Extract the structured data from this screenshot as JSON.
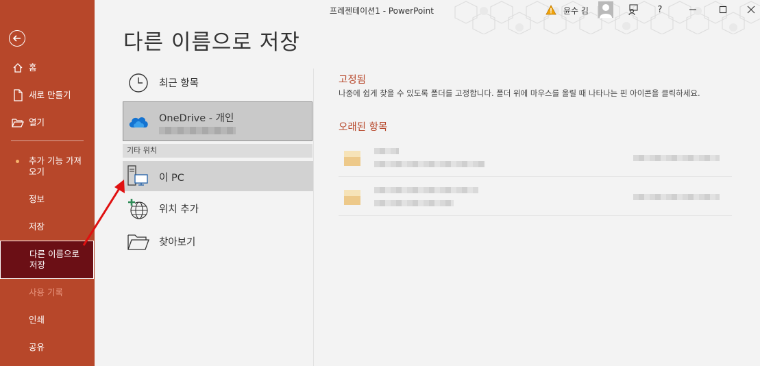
{
  "titlebar": {
    "doc_title": "프레젠테이션1  -  PowerPoint",
    "user_name": "윤수 김",
    "help": "?",
    "icons": [
      "warning-icon",
      "avatar",
      "coauthor-icon",
      "help-icon",
      "minimize-icon",
      "restore-icon",
      "close-icon"
    ]
  },
  "page": {
    "title": "다른 이름으로 저장"
  },
  "sidebar": {
    "back_icon": "back-arrow-icon",
    "items": [
      {
        "label": "홈",
        "icon": "home-icon"
      },
      {
        "label": "새로 만들기",
        "icon": "new-document-icon"
      },
      {
        "label": "열기",
        "icon": "open-folder-icon"
      },
      {
        "label": "추가 기능 가져오기"
      },
      {
        "label": "정보"
      },
      {
        "label": "저장"
      },
      {
        "label": "다른 이름으로 저장"
      },
      {
        "label": "사용 기록"
      },
      {
        "label": "인쇄"
      },
      {
        "label": "공유"
      }
    ],
    "selected": "다른 이름으로 저장",
    "accent": "#b7472a",
    "selected_bg": "#6b0f15"
  },
  "locations": {
    "recent": "최근 항목",
    "onedrive": "OneDrive - 개인",
    "other_header": "기타 위치",
    "this_pc": "이 PC",
    "add_place": "위치 추가",
    "browse": "찾아보기"
  },
  "right": {
    "pinned_title": "고정됨",
    "pinned_desc": "나중에 쉽게 찾을 수 있도록 폴더를 고정합니다. 폴더 위에 마우스를 올릴 때 나타나는 핀 아이콘을 클릭하세요.",
    "older_title": "오래된 항목"
  }
}
